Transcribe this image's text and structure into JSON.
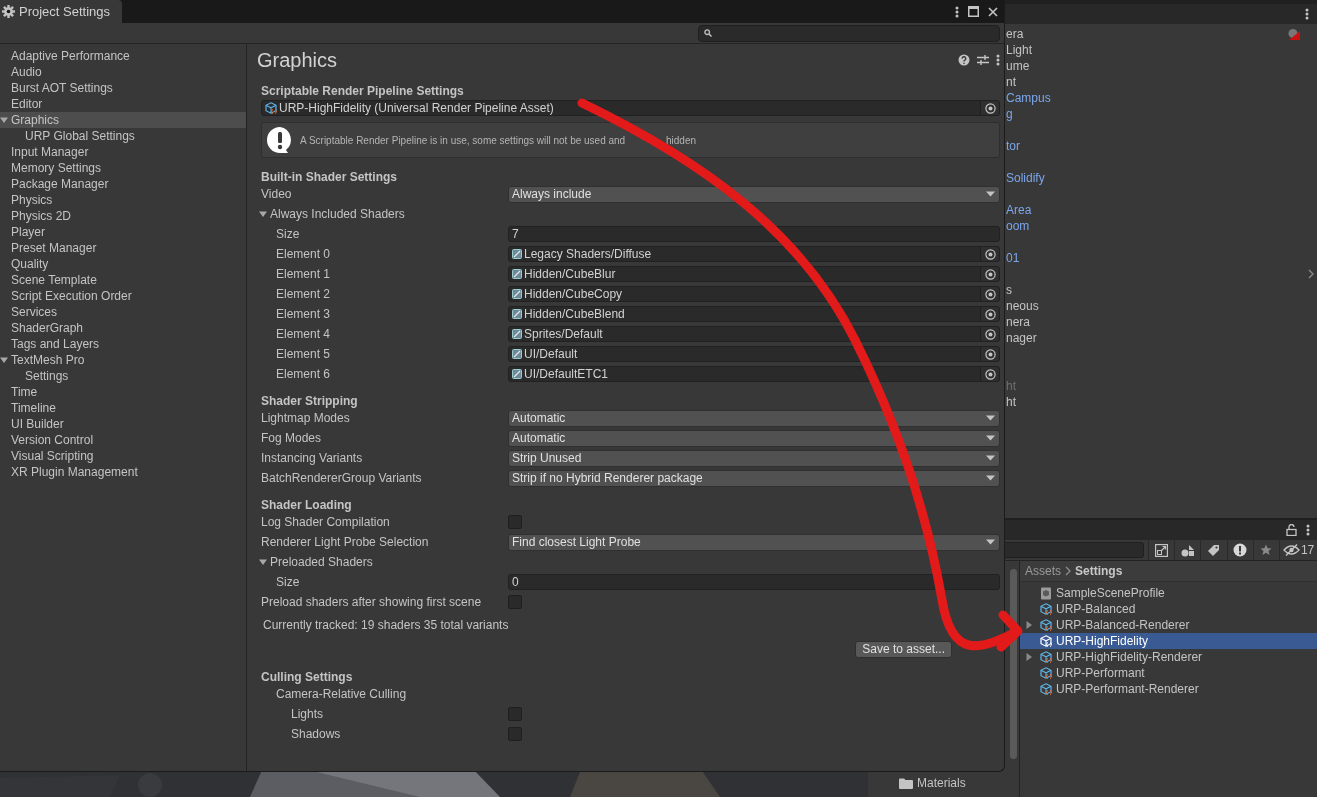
{
  "window": {
    "title": "Project Settings"
  },
  "sidebar": {
    "items": [
      {
        "label": "Adaptive Performance",
        "selected": false
      },
      {
        "label": "Audio",
        "selected": false
      },
      {
        "label": "Burst AOT Settings",
        "selected": false
      },
      {
        "label": "Editor",
        "selected": false
      },
      {
        "label": "Graphics",
        "selected": true,
        "expanded": true,
        "children": [
          {
            "label": "URP Global Settings",
            "selected": false
          }
        ]
      },
      {
        "label": "Input Manager",
        "selected": false
      },
      {
        "label": "Memory Settings",
        "selected": false
      },
      {
        "label": "Package Manager",
        "selected": false
      },
      {
        "label": "Physics",
        "selected": false
      },
      {
        "label": "Physics 2D",
        "selected": false
      },
      {
        "label": "Player",
        "selected": false
      },
      {
        "label": "Preset Manager",
        "selected": false
      },
      {
        "label": "Quality",
        "selected": false
      },
      {
        "label": "Scene Template",
        "selected": false
      },
      {
        "label": "Script Execution Order",
        "selected": false
      },
      {
        "label": "Services",
        "selected": false
      },
      {
        "label": "ShaderGraph",
        "selected": false
      },
      {
        "label": "Tags and Layers",
        "selected": false
      },
      {
        "label": "TextMesh Pro",
        "selected": false,
        "expanded": true,
        "children": [
          {
            "label": "Settings",
            "selected": false
          }
        ]
      },
      {
        "label": "Time",
        "selected": false
      },
      {
        "label": "Timeline",
        "selected": false
      },
      {
        "label": "UI Builder",
        "selected": false
      },
      {
        "label": "Version Control",
        "selected": false
      },
      {
        "label": "Visual Scripting",
        "selected": false
      },
      {
        "label": "XR Plugin Management",
        "selected": false
      }
    ]
  },
  "inspector": {
    "title": "Graphics",
    "rows": [
      {
        "kind": "section",
        "label": "Scriptable Render Pipeline Settings"
      },
      {
        "kind": "asset",
        "value": "URP-HighFidelity (Universal Render Pipeline Asset)"
      },
      {
        "kind": "help",
        "text": "A Scriptable Render Pipeline is in use, some settings will not be used and",
        "text_after": "hidden"
      },
      {
        "kind": "section",
        "label": "Built-in Shader Settings"
      },
      {
        "kind": "dropdown",
        "label": "Video",
        "value": "Always include"
      },
      {
        "kind": "foldout",
        "label": "Always Included Shaders",
        "expanded": true,
        "children": [
          {
            "kind": "number",
            "label": "Size",
            "value": "7"
          },
          {
            "kind": "shader",
            "label": "Element 0",
            "value": "Legacy Shaders/Diffuse"
          },
          {
            "kind": "shader",
            "label": "Element 1",
            "value": "Hidden/CubeBlur"
          },
          {
            "kind": "shader",
            "label": "Element 2",
            "value": "Hidden/CubeCopy"
          },
          {
            "kind": "shader",
            "label": "Element 3",
            "value": "Hidden/CubeBlend"
          },
          {
            "kind": "shader",
            "label": "Element 4",
            "value": "Sprites/Default"
          },
          {
            "kind": "shader",
            "label": "Element 5",
            "value": "UI/Default"
          },
          {
            "kind": "shader",
            "label": "Element 6",
            "value": "UI/DefaultETC1"
          }
        ]
      },
      {
        "kind": "section",
        "label": "Shader Stripping"
      },
      {
        "kind": "dropdown",
        "label": "Lightmap Modes",
        "value": "Automatic"
      },
      {
        "kind": "dropdown",
        "label": "Fog Modes",
        "value": "Automatic"
      },
      {
        "kind": "dropdown",
        "label": "Instancing Variants",
        "value": "Strip Unused"
      },
      {
        "kind": "dropdown",
        "label": "BatchRendererGroup Variants",
        "value": "Strip if no Hybrid Renderer package"
      },
      {
        "kind": "section",
        "label": "Shader Loading"
      },
      {
        "kind": "checkbox",
        "label": "Log Shader Compilation",
        "checked": false
      },
      {
        "kind": "dropdown",
        "label": "Renderer Light Probe Selection",
        "value": "Find closest Light Probe"
      },
      {
        "kind": "foldout",
        "label": "Preloaded Shaders",
        "expanded": true,
        "children": [
          {
            "kind": "number",
            "label": "Size",
            "value": "0"
          }
        ]
      },
      {
        "kind": "checkbox",
        "label": "Preload shaders after showing first scene",
        "checked": false
      },
      {
        "kind": "note",
        "text": "Currently tracked: 19 shaders 35 total variants"
      },
      {
        "kind": "buttons",
        "buttons": [
          {
            "kind": "text",
            "label": "Save to asset..."
          }
        ]
      },
      {
        "kind": "section",
        "label": "Culling Settings"
      },
      {
        "kind": "group",
        "label": "Camera-Relative Culling",
        "children": [
          {
            "kind": "checkbox",
            "label": "Lights",
            "checked": false
          },
          {
            "kind": "checkbox",
            "label": "Shadows",
            "checked": false
          }
        ]
      }
    ]
  },
  "hierarchy": {
    "rows": [
      {
        "kind": "text",
        "label": "era",
        "prefab": false,
        "disabled": false
      },
      {
        "kind": "text",
        "label": "Light",
        "prefab": false,
        "disabled": false
      },
      {
        "kind": "text",
        "label": "ume",
        "prefab": false,
        "disabled": false
      },
      {
        "kind": "text",
        "label": "nt",
        "prefab": false,
        "disabled": false
      },
      {
        "kind": "text",
        "label": "Campus",
        "prefab": true,
        "disabled": false
      },
      {
        "kind": "text",
        "label": "g",
        "prefab": true,
        "disabled": false
      },
      {
        "kind": "blank"
      },
      {
        "kind": "text",
        "label": "tor",
        "prefab": true,
        "disabled": false
      },
      {
        "kind": "blank"
      },
      {
        "kind": "text",
        "label": "Solidify",
        "prefab": true,
        "disabled": false
      },
      {
        "kind": "blank"
      },
      {
        "kind": "text",
        "label": "Area",
        "prefab": true,
        "disabled": false
      },
      {
        "kind": "text",
        "label": "oom",
        "prefab": true,
        "disabled": false
      },
      {
        "kind": "blank"
      },
      {
        "kind": "text",
        "label": "01",
        "prefab": true,
        "disabled": false
      },
      {
        "kind": "blank"
      },
      {
        "kind": "text",
        "label": "s",
        "prefab": false,
        "disabled": false
      },
      {
        "kind": "text",
        "label": "neous",
        "prefab": false,
        "disabled": false
      },
      {
        "kind": "text",
        "label": "nera",
        "prefab": false,
        "disabled": false
      },
      {
        "kind": "text",
        "label": "nager",
        "prefab": false,
        "disabled": false
      },
      {
        "kind": "blank"
      },
      {
        "kind": "blank"
      },
      {
        "kind": "text",
        "label": "ht",
        "prefab": false,
        "disabled": true
      },
      {
        "kind": "text",
        "label": "ht",
        "prefab": false,
        "disabled": false
      }
    ]
  },
  "project": {
    "hidden_count": "17",
    "folders": [
      {
        "label": "Materials"
      }
    ],
    "breadcrumb": [
      "Assets",
      "Settings"
    ],
    "items": [
      {
        "kind": "profile",
        "label": "SampleSceneProfile",
        "selected": false,
        "expandable": false
      },
      {
        "kind": "asset",
        "label": "URP-Balanced",
        "selected": false,
        "expandable": false
      },
      {
        "kind": "asset",
        "label": "URP-Balanced-Renderer",
        "selected": false,
        "expandable": true
      },
      {
        "kind": "asset",
        "label": "URP-HighFidelity",
        "selected": true,
        "expandable": false
      },
      {
        "kind": "asset",
        "label": "URP-HighFidelity-Renderer",
        "selected": false,
        "expandable": true
      },
      {
        "kind": "asset",
        "label": "URP-Performant",
        "selected": false,
        "expandable": false
      },
      {
        "kind": "asset",
        "label": "URP-Performant-Renderer",
        "selected": false,
        "expandable": false
      }
    ]
  }
}
